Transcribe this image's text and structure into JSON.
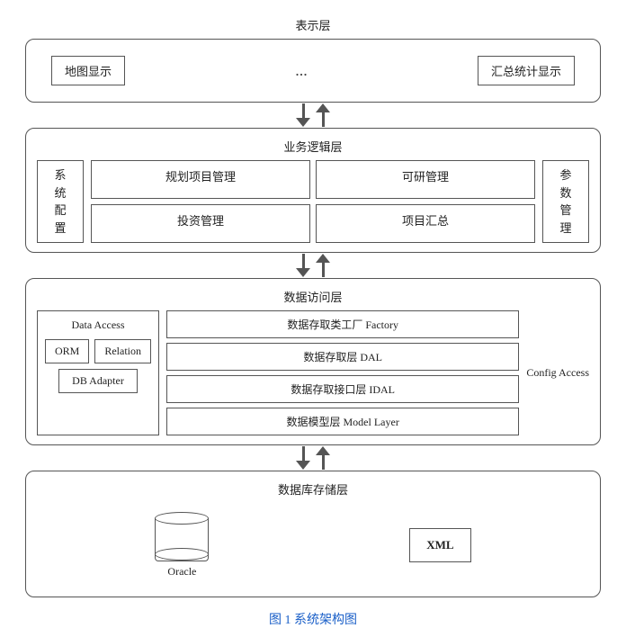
{
  "title": "系统架构图",
  "figure_label": "图 1  系统架构图",
  "layers": {
    "presentation": {
      "label": "表示层",
      "boxes": [
        "地图显示",
        "...",
        "汇总统计显示"
      ]
    },
    "business": {
      "label": "业务逻辑层",
      "left_box": "系\n统\n配\n置",
      "grid": [
        "规划项目管理",
        "可研管理",
        "投资管理",
        "项目汇总"
      ],
      "right_box": "参\n数\n管\n理"
    },
    "data_access": {
      "label": "数据访问层",
      "left_title": "Data Access",
      "left_items": [
        "ORM",
        "Relation",
        "DB Adapter"
      ],
      "center_items": [
        "数据存取类工厂 Factory",
        "数据存取层 DAL",
        "数据存取接口层 IDAL",
        "数据模型层 Model Layer"
      ],
      "right_label": "Config Access"
    },
    "storage": {
      "label": "数据库存储层",
      "items": [
        {
          "name": "Oracle",
          "type": "cylinder"
        },
        {
          "name": "XML",
          "type": "box"
        }
      ]
    }
  }
}
